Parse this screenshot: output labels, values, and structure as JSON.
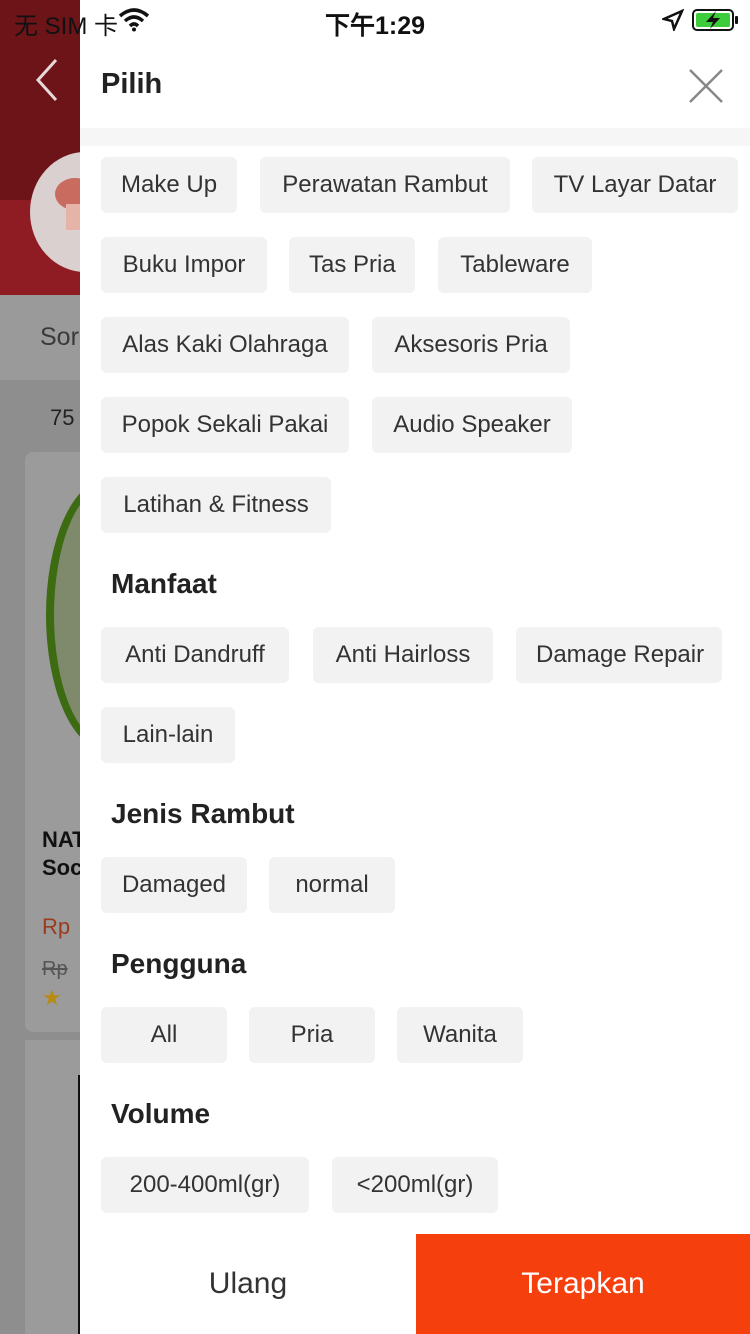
{
  "status_bar": {
    "carrier": "无 SIM 卡",
    "time": "下午1:29"
  },
  "background_page": {
    "sort_label": "Sor",
    "count": "75",
    "product_name_lines": [
      "NAT",
      "Soc"
    ],
    "price": "Rp",
    "old_price": "Rp",
    "star": "★"
  },
  "drawer": {
    "title": "Pilih",
    "categories": [
      "Make Up",
      "Perawatan Rambut",
      "TV Layar Datar",
      "Buku Impor",
      "Tas Pria",
      "Tableware",
      "Alas Kaki Olahraga",
      "Aksesoris Pria",
      "Popok Sekali Pakai",
      "Audio Speaker",
      "Latihan & Fitness"
    ],
    "sections": {
      "manfaat": {
        "title": "Manfaat",
        "options": [
          "Anti Dandruff",
          "Anti Hairloss",
          "Damage Repair",
          "Lain-lain"
        ]
      },
      "jenis_rambut": {
        "title": "Jenis Rambut",
        "options": [
          "Damaged",
          "normal"
        ]
      },
      "pengguna": {
        "title": "Pengguna",
        "options": [
          "All",
          "Pria",
          "Wanita"
        ]
      },
      "volume": {
        "title": "Volume",
        "options": [
          "200-400ml(gr)",
          "<200ml(gr)"
        ]
      }
    },
    "footer": {
      "reset_label": "Ulang",
      "apply_label": "Terapkan"
    }
  },
  "colors": {
    "accent": "#f5400d",
    "chip_bg": "#f2f2f2",
    "header_bg": "#6d1418"
  }
}
